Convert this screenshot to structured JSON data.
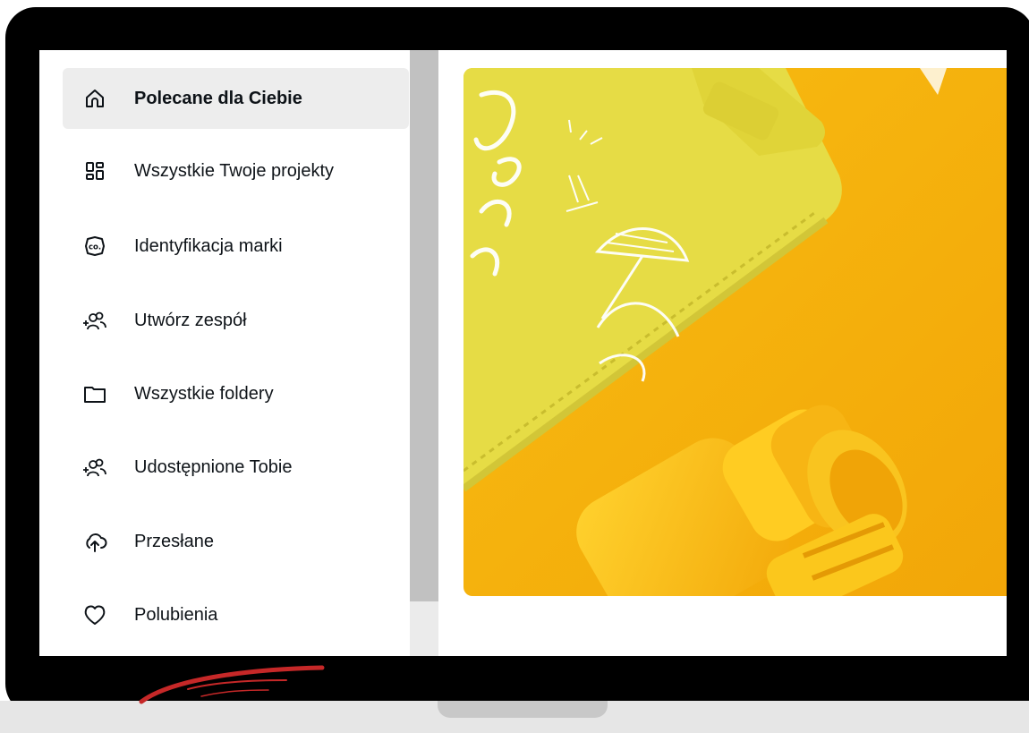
{
  "sidebar": {
    "items": [
      {
        "label": "Polecane dla Ciebie",
        "icon": "home-icon",
        "active": true
      },
      {
        "label": "Wszystkie Twoje projekty",
        "icon": "grid-icon",
        "active": false
      },
      {
        "label": "Identyfikacja marki",
        "icon": "brand-kit-icon",
        "active": false
      },
      {
        "label": "Utwórz zespół",
        "icon": "add-team-icon",
        "active": false
      },
      {
        "label": "Wszystkie foldery",
        "icon": "folder-icon",
        "active": false
      },
      {
        "label": "Udostępnione Tobie",
        "icon": "shared-people-icon",
        "active": false
      },
      {
        "label": "Przesłane",
        "icon": "cloud-upload-icon",
        "active": false
      },
      {
        "label": "Polubienia",
        "icon": "heart-icon",
        "active": false
      }
    ]
  },
  "brand_icon_text": "co.",
  "hero": {
    "image": "yellow notebook and binoculars photo",
    "lettering": "THE Sea"
  },
  "colors": {
    "active_bg": "#ededed",
    "hero_orange": "#f5b10a",
    "notebook_yellow": "#e9df4a",
    "frame": "#000000"
  }
}
